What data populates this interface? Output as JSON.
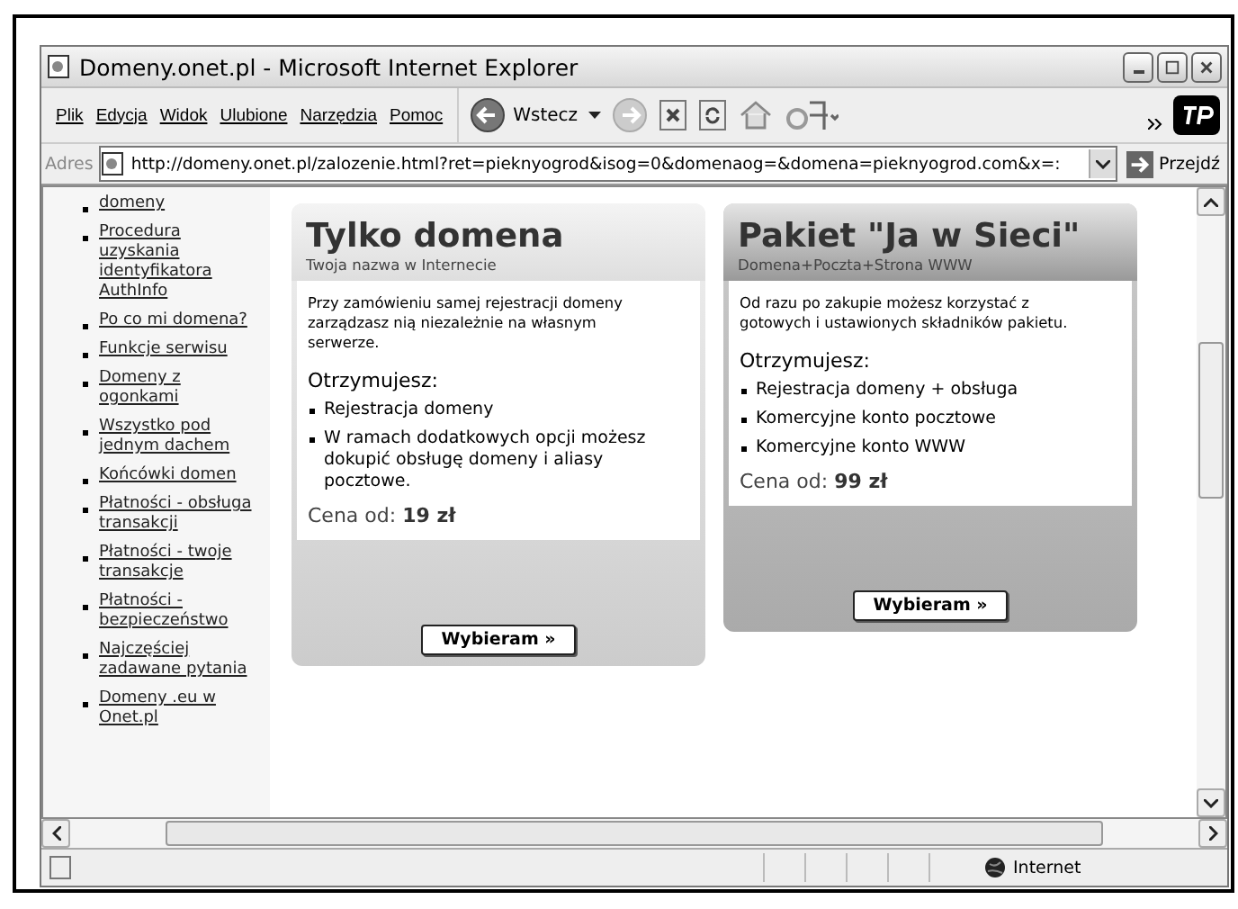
{
  "window": {
    "title": "Domeny.onet.pl - Microsoft Internet Explorer"
  },
  "menu": [
    "Plik",
    "Edycja",
    "Widok",
    "Ulubione",
    "Narzędzia",
    "Pomoc"
  ],
  "toolbar": {
    "back_label": "Wstecz"
  },
  "address": {
    "label": "Adres",
    "url": "http://domeny.onet.pl/zalozenie.html?ret=pieknyogrod&isog=0&domenaog=&domena=pieknyogrod.com&x=:",
    "go_label": "Przejdź"
  },
  "sidebar": {
    "items": [
      "domeny",
      "Procedura uzyskania identyfikatora AuthInfo",
      "Po co mi domena?",
      "Funkcje serwisu",
      "Domeny z ogonkami",
      "Wszystko pod jednym dachem",
      "Końcówki domen",
      "Płatności - obsługa transakcji",
      "Płatności - twoje transakcje",
      "Płatności - bezpieczeństwo",
      "Najczęściej zadawane pytania",
      "Domeny .eu w Onet.pl"
    ]
  },
  "cards": [
    {
      "title": "Tylko domena",
      "subtitle": "Twoja nazwa w Internecie",
      "highlighted": false,
      "description": "Przy zamówieniu samej rejestracji domeny zarządzasz nią niezależnie na własnym serwerze.",
      "receive_label": "Otrzymujesz:",
      "features": [
        "Rejestracja domeny",
        "W ramach dodatkowych opcji możesz dokupić obsługę domeny i aliasy pocztowe."
      ],
      "price_label": "Cena od:",
      "price": "19 zł",
      "button": "Wybieram »"
    },
    {
      "title": "Pakiet \"Ja w Sieci\"",
      "subtitle": "Domena+Poczta+Strona WWW",
      "highlighted": true,
      "description": "Od razu po zakupie możesz korzystać z gotowych i ustawionych składników pakietu.",
      "receive_label": "Otrzymujesz:",
      "features": [
        "Rejestracja domeny + obsługa",
        "Komercyjne konto pocztowe",
        "Komercyjne konto WWW"
      ],
      "price_label": "Cena od:",
      "price": "99 zł",
      "button": "Wybieram »"
    }
  ],
  "status_bar": {
    "zone": "Internet"
  }
}
